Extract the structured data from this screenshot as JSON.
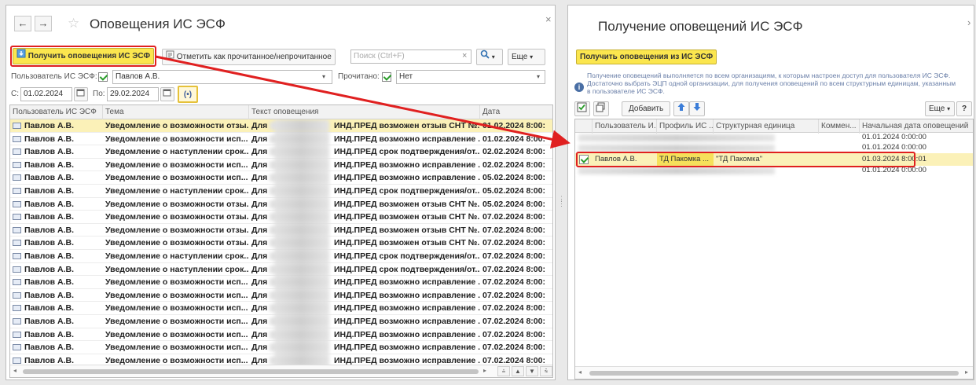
{
  "left": {
    "nav_back": "←",
    "nav_forward": "→",
    "title": "Оповещения ИС ЭСФ",
    "close": "×",
    "btn_get": "Получить оповещения ИС ЭСФ",
    "btn_mark": "Отметить как прочитанное/непрочитанное",
    "search_placeholder": "Поиск (Ctrl+F)",
    "search_clear": "×",
    "more": "Еще",
    "filter_user_label": "Пользователь ИС ЭСФ:",
    "filter_user_value": "Павлов А.В.",
    "filter_read_label": "Прочитано:",
    "filter_read_value": "Нет",
    "date_from_label": "С:",
    "date_from": "01.02.2024",
    "date_to_label": "По:",
    "date_to": "29.02.2024",
    "period_btn": "(•)",
    "columns": [
      "Пользователь ИС ЭСФ",
      "Тема",
      "Текст оповещения",
      "Дата"
    ],
    "rows": [
      {
        "user": "Павлов А.В.",
        "topic": "Уведомление о возможности отзы...",
        "pre": "Для",
        "text": "ИНД.ПРЕД возможен отзыв СНТ №...",
        "date": "01.02.2024 8:00:"
      },
      {
        "user": "Павлов А.В.",
        "topic": "Уведомление о возможности исп...",
        "pre": "Для",
        "text": "ИНД.ПРЕД возможно исправление ...",
        "date": "01.02.2024 8:00:"
      },
      {
        "user": "Павлов А.В.",
        "topic": "Уведомление о наступлении срок...",
        "pre": "Для",
        "text": "ИНД.ПРЕД срок подтверждения/от...",
        "date": "02.02.2024 8:00:"
      },
      {
        "user": "Павлов А.В.",
        "topic": "Уведомление о возможности исп...",
        "pre": "Для",
        "text": "ИНД.ПРЕД возможно исправление ...",
        "date": "02.02.2024 8:00:"
      },
      {
        "user": "Павлов А.В.",
        "topic": "Уведомление о возможности исп...",
        "pre": "Для",
        "text": "ИНД.ПРЕД возможно исправление ...",
        "date": "05.02.2024 8:00:"
      },
      {
        "user": "Павлов А.В.",
        "topic": "Уведомление о наступлении срок...",
        "pre": "Для",
        "text": "ИНД.ПРЕД срок подтверждения/от...",
        "date": "05.02.2024 8:00:"
      },
      {
        "user": "Павлов А.В.",
        "topic": "Уведомление о возможности отзы...",
        "pre": "Для",
        "text": "ИНД.ПРЕД возможен отзыв СНТ №...",
        "date": "05.02.2024 8:00:"
      },
      {
        "user": "Павлов А.В.",
        "topic": "Уведомление о возможности отзы...",
        "pre": "Для",
        "text": "ИНД.ПРЕД возможен отзыв СНТ №...",
        "date": "07.02.2024 8:00:"
      },
      {
        "user": "Павлов А.В.",
        "topic": "Уведомление о возможности отзы...",
        "pre": "Для",
        "text": "ИНД.ПРЕД возможен отзыв СНТ №...",
        "date": "07.02.2024 8:00:"
      },
      {
        "user": "Павлов А.В.",
        "topic": "Уведомление о возможности отзы...",
        "pre": "Для",
        "text": "ИНД.ПРЕД возможен отзыв СНТ №...",
        "date": "07.02.2024 8:00:"
      },
      {
        "user": "Павлов А.В.",
        "topic": "Уведомление о наступлении срок...",
        "pre": "Для",
        "text": "ИНД.ПРЕД срок подтверждения/от...",
        "date": "07.02.2024 8:00:"
      },
      {
        "user": "Павлов А.В.",
        "topic": "Уведомление о наступлении срок...",
        "pre": "Для",
        "text": "ИНД.ПРЕД срок подтверждения/от...",
        "date": "07.02.2024 8:00:"
      },
      {
        "user": "Павлов А.В.",
        "topic": "Уведомление о возможности исп...",
        "pre": "Для",
        "text": "ИНД.ПРЕД возможно исправление ...",
        "date": "07.02.2024 8:00:"
      },
      {
        "user": "Павлов А.В.",
        "topic": "Уведомление о возможности исп...",
        "pre": "Для",
        "text": "ИНД.ПРЕД возможно исправление ...",
        "date": "07.02.2024 8:00:"
      },
      {
        "user": "Павлов А.В.",
        "topic": "Уведомление о возможности исп...",
        "pre": "Для",
        "text": "ИНД.ПРЕД возможно исправление ...",
        "date": "07.02.2024 8:00:"
      },
      {
        "user": "Павлов А.В.",
        "topic": "Уведомление о возможности исп...",
        "pre": "Для",
        "text": "ИНД.ПРЕД возможно исправление ...",
        "date": "07.02.2024 8:00:"
      },
      {
        "user": "Павлов А.В.",
        "topic": "Уведомление о возможности исп...",
        "pre": "Для",
        "text": "ИНД.ПРЕД возможно исправление ...",
        "date": "07.02.2024 8:00:"
      },
      {
        "user": "Павлов А.В.",
        "topic": "Уведомление о возможности исп...",
        "pre": "Для",
        "text": "ИНД.ПРЕД возможно исправление ...",
        "date": "07.02.2024 8:00:"
      },
      {
        "user": "Павлов А.В.",
        "topic": "Уведомление о возможности исп...",
        "pre": "Для",
        "text": "ИНД.ПРЕД возможно исправление ...",
        "date": "07.02.2024 8:00:"
      },
      {
        "user": "Павлов А.В.",
        "topic": "Уведомление о возможности исп...",
        "pre": "Для",
        "text": "ИНД.ПРЕД возможно исправление ...",
        "date": "07.02.2024 8:00:"
      }
    ]
  },
  "right": {
    "title": "Получение оповещений ИС ЭСФ",
    "close": "›",
    "btn_get": "Получить оповещения из ИС ЭСФ",
    "info": "Получение оповещений выполняется по всем организациям, к которым настроен доступ для пользователя ИС ЭСФ. Достаточно выбрать ЭЦП одной организации, для получения оповещений по всем структурным единицам, указанным в пользователе ИС ЭСФ.",
    "btn_add": "Добавить",
    "more": "Еще",
    "help": "?",
    "columns": [
      "Пользователь И...",
      "Профиль ИС ...",
      "Структурная единица",
      "Коммен...",
      "Начальная дата оповещений"
    ],
    "rows": [
      {
        "check": false,
        "user": "",
        "profile": "",
        "unit": "",
        "date": "01.01.2024 0:00:00"
      },
      {
        "check": false,
        "user": "",
        "profile": "",
        "unit": "",
        "date": "01.01.2024 0:00:00"
      },
      {
        "check": true,
        "user": "Павлов А.В.",
        "profile": "ТД Пакомка ...",
        "unit": "\"ТД Пакомка\"",
        "date": "01.03.2024 8:00:01"
      },
      {
        "check": false,
        "user": "",
        "profile": "",
        "unit": "",
        "date": "01.01.2024 0:00:00"
      }
    ]
  }
}
